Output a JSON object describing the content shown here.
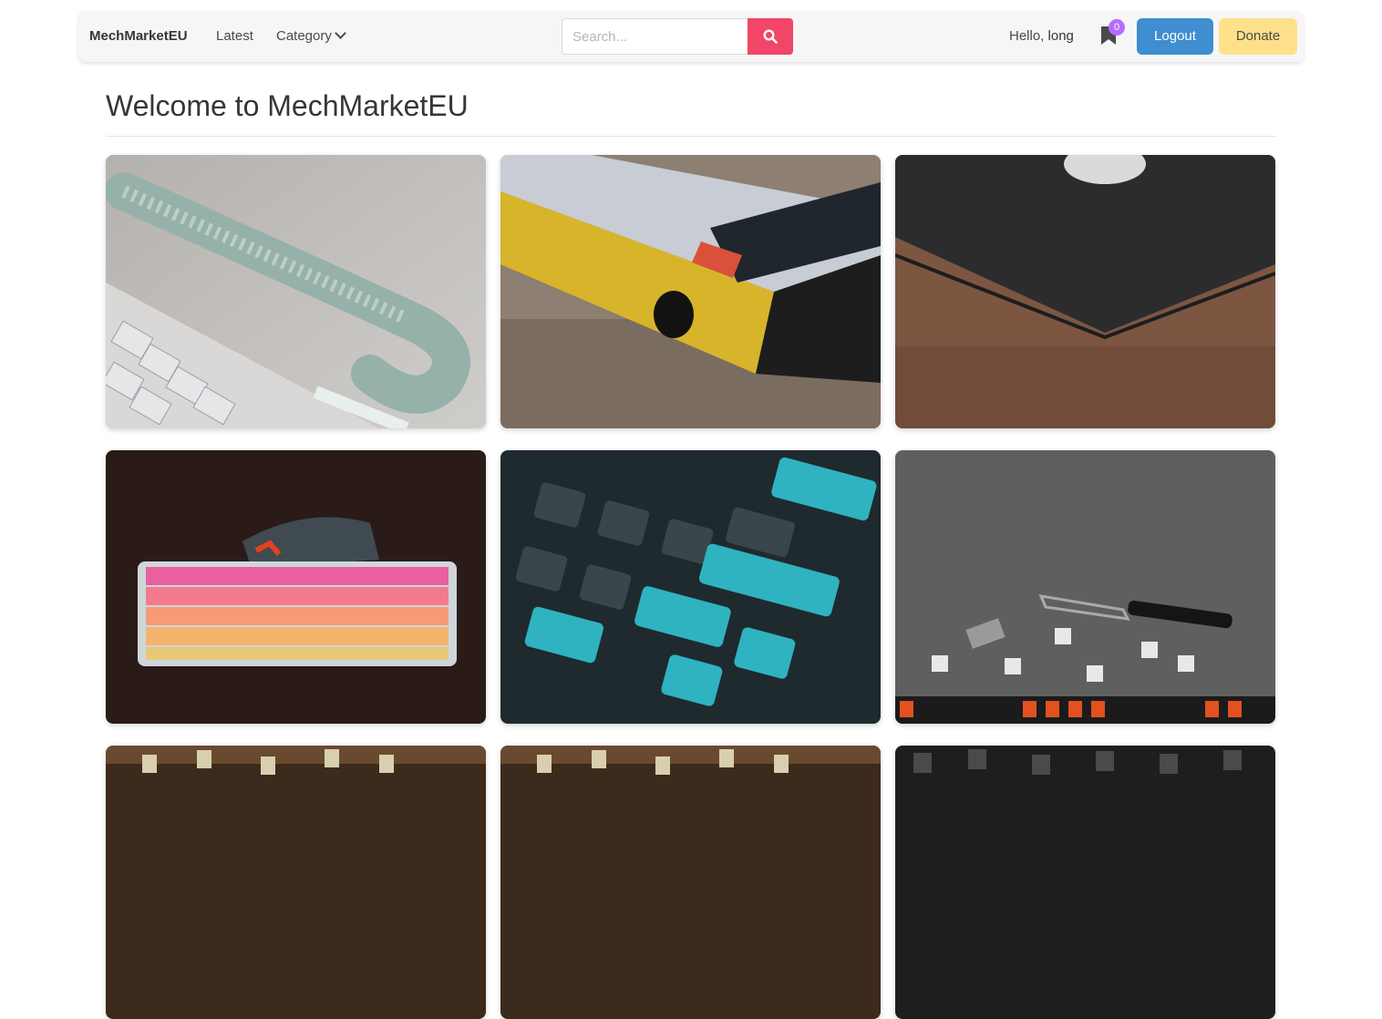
{
  "navbar": {
    "brand": "MechMarketEU",
    "latest": "Latest",
    "category": "Category",
    "search_placeholder": "Search...",
    "greeting": "Hello, ",
    "username": "long",
    "bookmark_count": "0",
    "logout": "Logout",
    "donate": "Donate"
  },
  "page": {
    "title": "Welcome to MechMarketEU"
  },
  "colors": {
    "search_button": "#f14668",
    "logout": "#3e8ed0",
    "donate": "#ffe08a",
    "badge": "#b86bff"
  },
  "gallery": [
    {
      "name": "coiled-cable-photo"
    },
    {
      "name": "yellow-keyboard-photo"
    },
    {
      "name": "desk-mat-photo"
    },
    {
      "name": "pink-keyboard-photo"
    },
    {
      "name": "teal-keycaps-photo"
    },
    {
      "name": "keycap-puller-photo"
    },
    {
      "name": "switches-photo-1"
    },
    {
      "name": "switches-photo-2"
    },
    {
      "name": "switches-photo-3"
    }
  ]
}
